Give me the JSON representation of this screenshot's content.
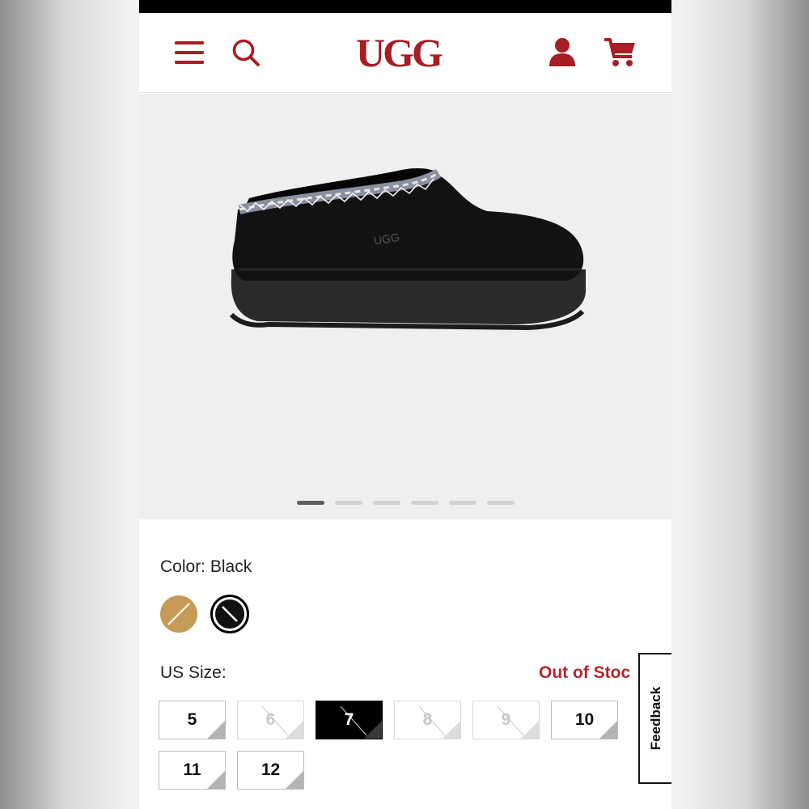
{
  "header": {
    "logo_text": "UGG",
    "icons": [
      "menu-icon",
      "search-icon",
      "account-icon",
      "cart-icon"
    ],
    "brand_color": "#a71d24"
  },
  "gallery": {
    "image_count": 6,
    "active_index": 0
  },
  "product": {
    "color_label": "Color: Black",
    "swatches": [
      {
        "name": "chestnut",
        "color": "#c69a57",
        "selected": false
      },
      {
        "name": "black",
        "color": "#111111",
        "selected": true
      }
    ],
    "size_label": "US Size:",
    "out_of_stock_text": "Out of Stoc",
    "sizes": [
      {
        "label": "5",
        "state": "available"
      },
      {
        "label": "6",
        "state": "disabled"
      },
      {
        "label": "7",
        "state": "selected"
      },
      {
        "label": "8",
        "state": "disabled"
      },
      {
        "label": "9",
        "state": "disabled"
      },
      {
        "label": "10",
        "state": "available"
      },
      {
        "label": "11",
        "state": "available"
      },
      {
        "label": "12",
        "state": "available"
      }
    ],
    "out_of_stock_color": "#b0282d"
  },
  "feedback": {
    "label": "Feedback"
  }
}
